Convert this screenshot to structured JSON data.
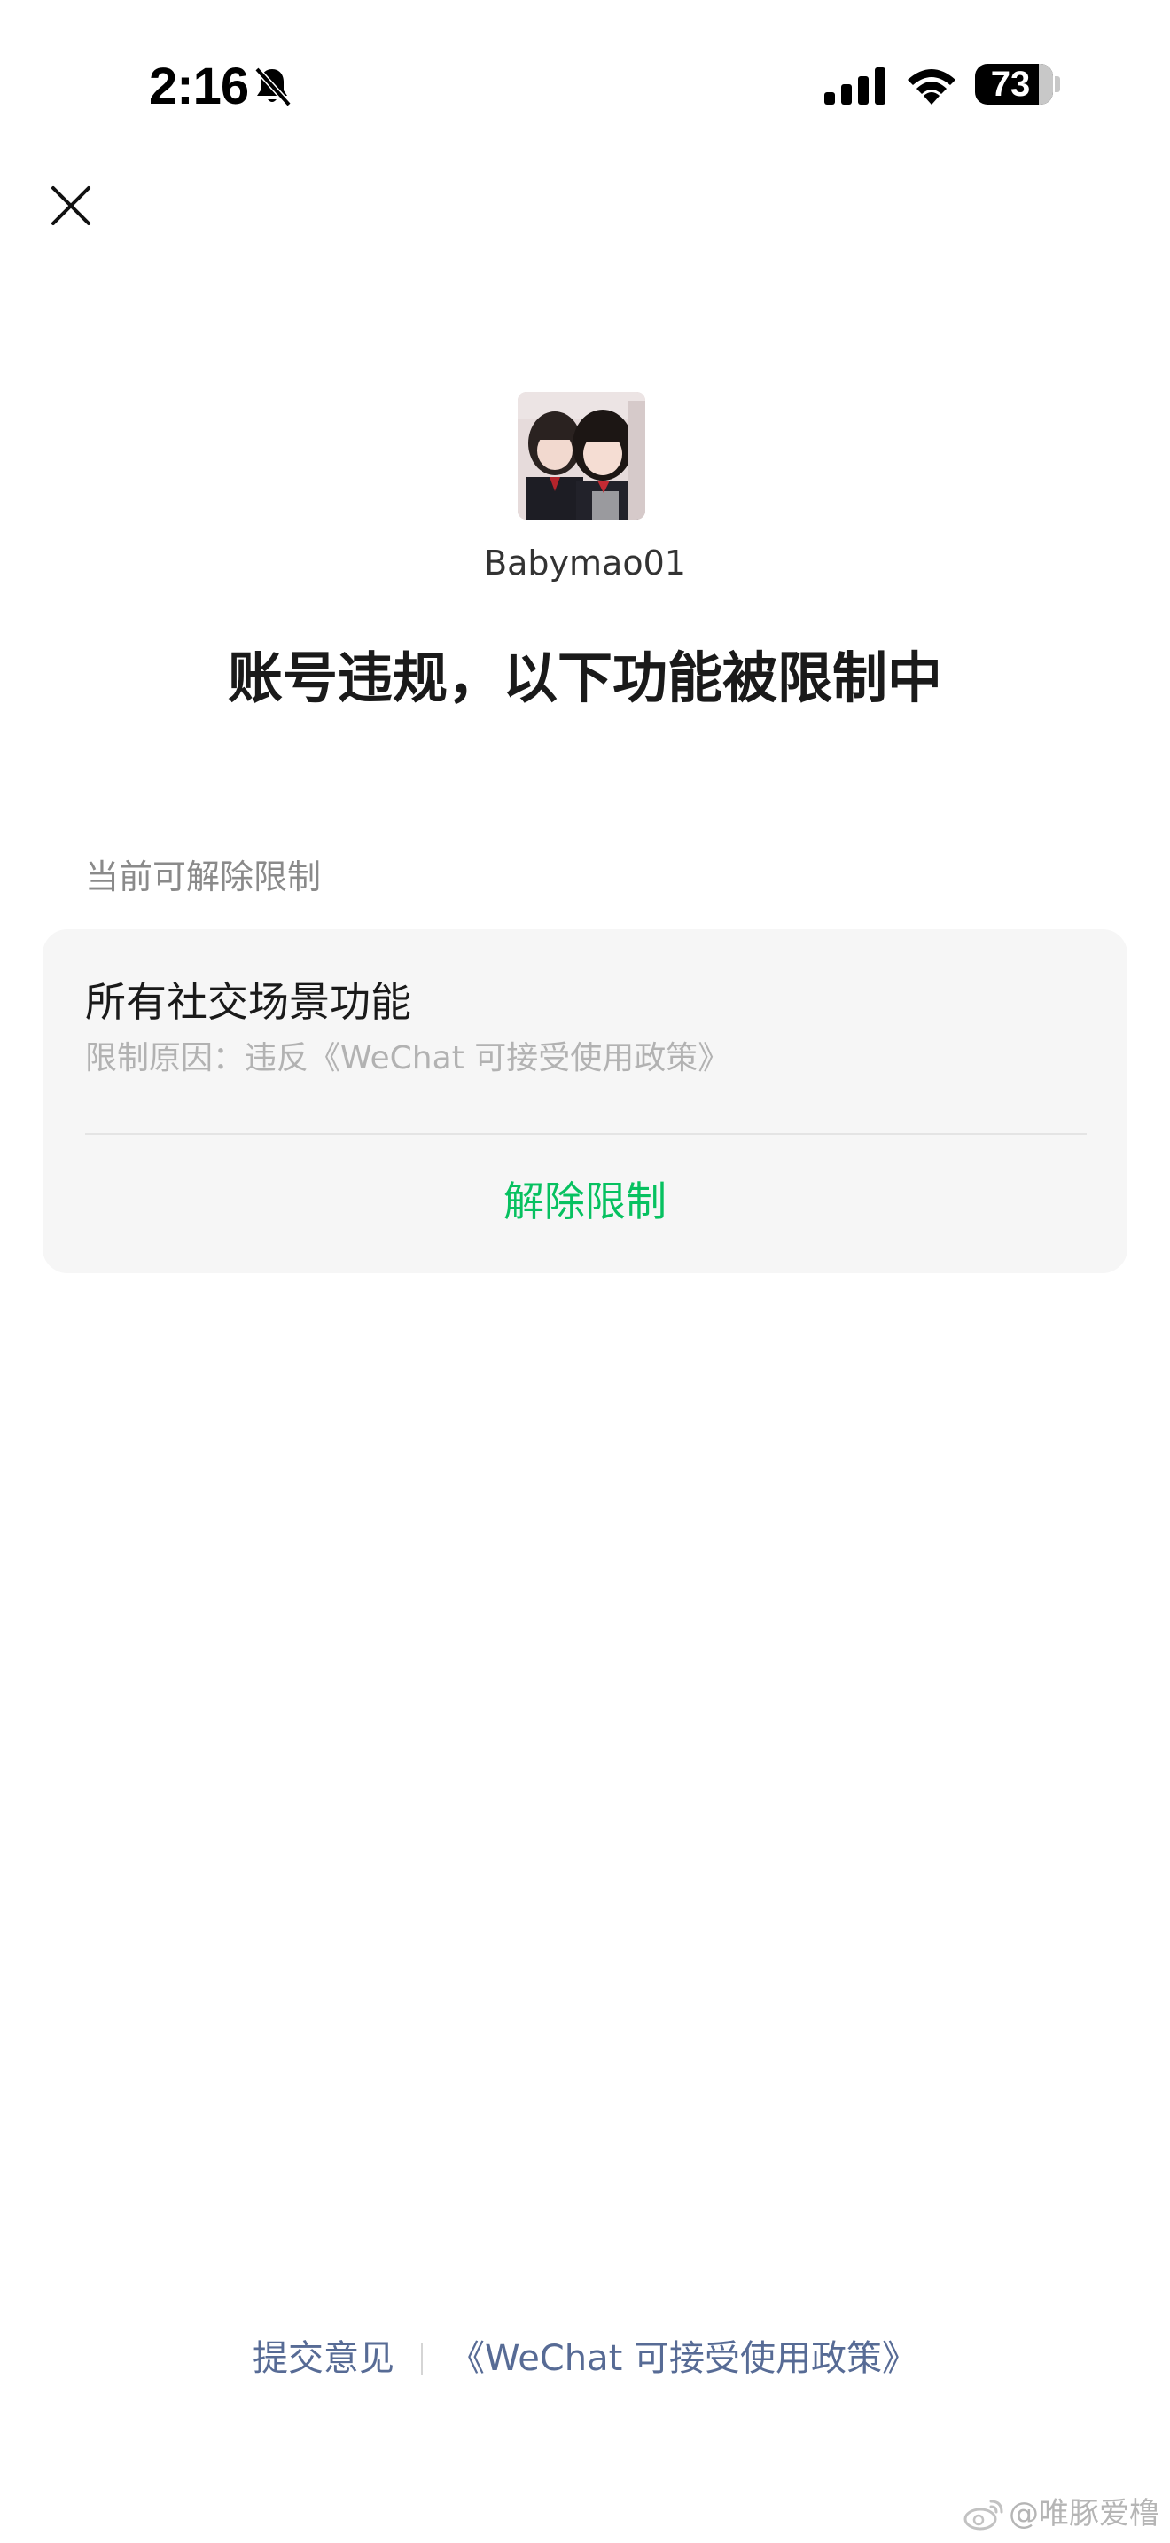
{
  "status_bar": {
    "time": "2:16",
    "battery_percent": "73",
    "silent_icon": "bell-slash-icon",
    "signal_icon": "cellular-signal-icon",
    "wifi_icon": "wifi-icon",
    "battery_icon": "battery-icon"
  },
  "header": {
    "close_icon": "close-icon"
  },
  "profile": {
    "username": "Babymao01"
  },
  "main": {
    "headline": "账号违规，以下功能被限制中",
    "section_label": "当前可解除限制",
    "restriction": {
      "title": "所有社交场景功能",
      "reason": "限制原因：违反《WeChat 可接受使用政策》",
      "action_label": "解除限制"
    }
  },
  "footer": {
    "feedback_label": "提交意见",
    "policy_label": "《WeChat 可接受使用政策》"
  },
  "watermark": {
    "text": "@唯豚爱橹",
    "icon": "weibo-icon"
  },
  "colors": {
    "accent_green": "#07c160",
    "link_blue": "#576b95",
    "card_bg": "#f6f6f6"
  }
}
